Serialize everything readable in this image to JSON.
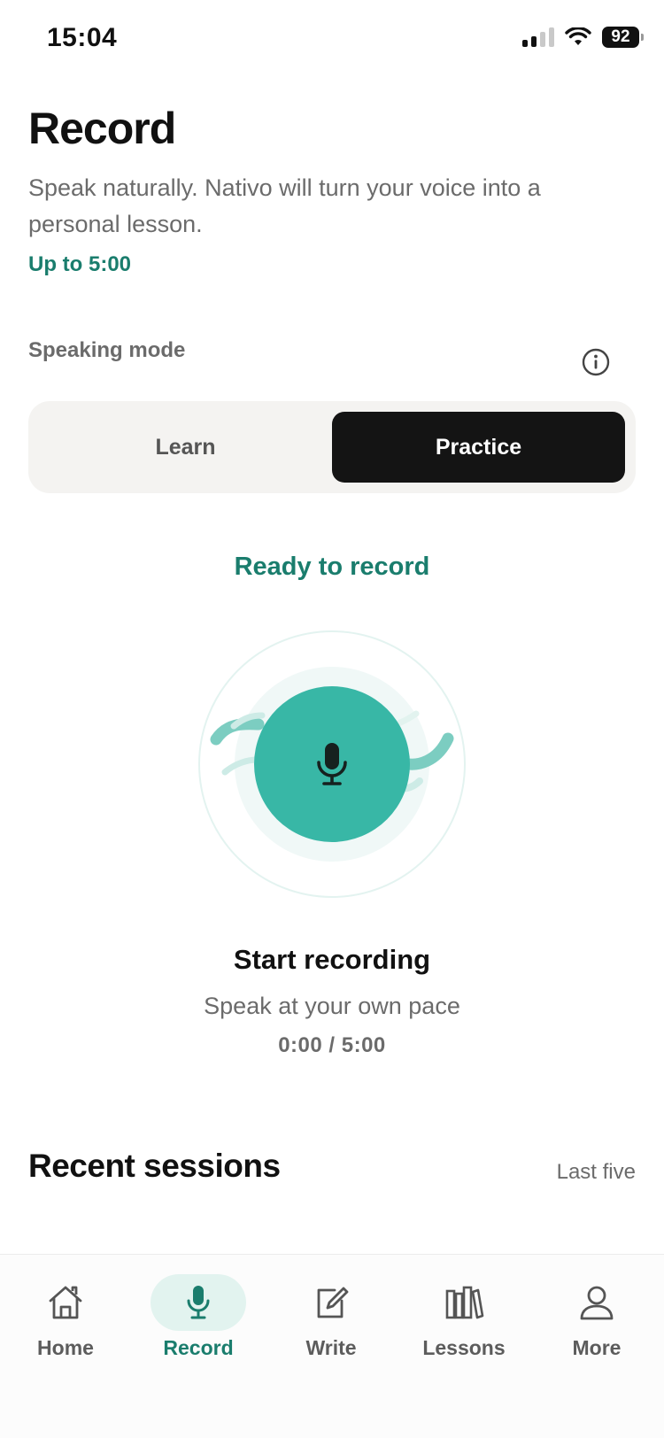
{
  "status_bar": {
    "time": "15:04",
    "battery": "92"
  },
  "header": {
    "title": "Record",
    "subtitle": "Speak naturally. Nativo will turn your voice into a personal lesson.",
    "limit": "Up to 5:00"
  },
  "speaking_mode": {
    "label": "Speaking mode",
    "options": [
      {
        "label": "Learn",
        "selected": false
      },
      {
        "label": "Practice",
        "selected": true
      }
    ]
  },
  "recorder": {
    "status": "Ready to record",
    "title": "Start recording",
    "subtitle": "Speak at your own pace",
    "timer": "0:00 / 5:00"
  },
  "recent_sessions": {
    "title": "Recent sessions",
    "meta": "Last five"
  },
  "tabs": [
    {
      "label": "Home",
      "icon": "home-icon",
      "active": false
    },
    {
      "label": "Record",
      "icon": "microphone-icon",
      "active": true
    },
    {
      "label": "Write",
      "icon": "edit-icon",
      "active": false
    },
    {
      "label": "Lessons",
      "icon": "books-icon",
      "active": false
    },
    {
      "label": "More",
      "icon": "person-icon",
      "active": false
    }
  ],
  "colors": {
    "accent": "#1a7d6d",
    "mic_button": "#38b7a6",
    "active_tab_bg": "#e2f3ef",
    "segment_active": "#141414"
  }
}
